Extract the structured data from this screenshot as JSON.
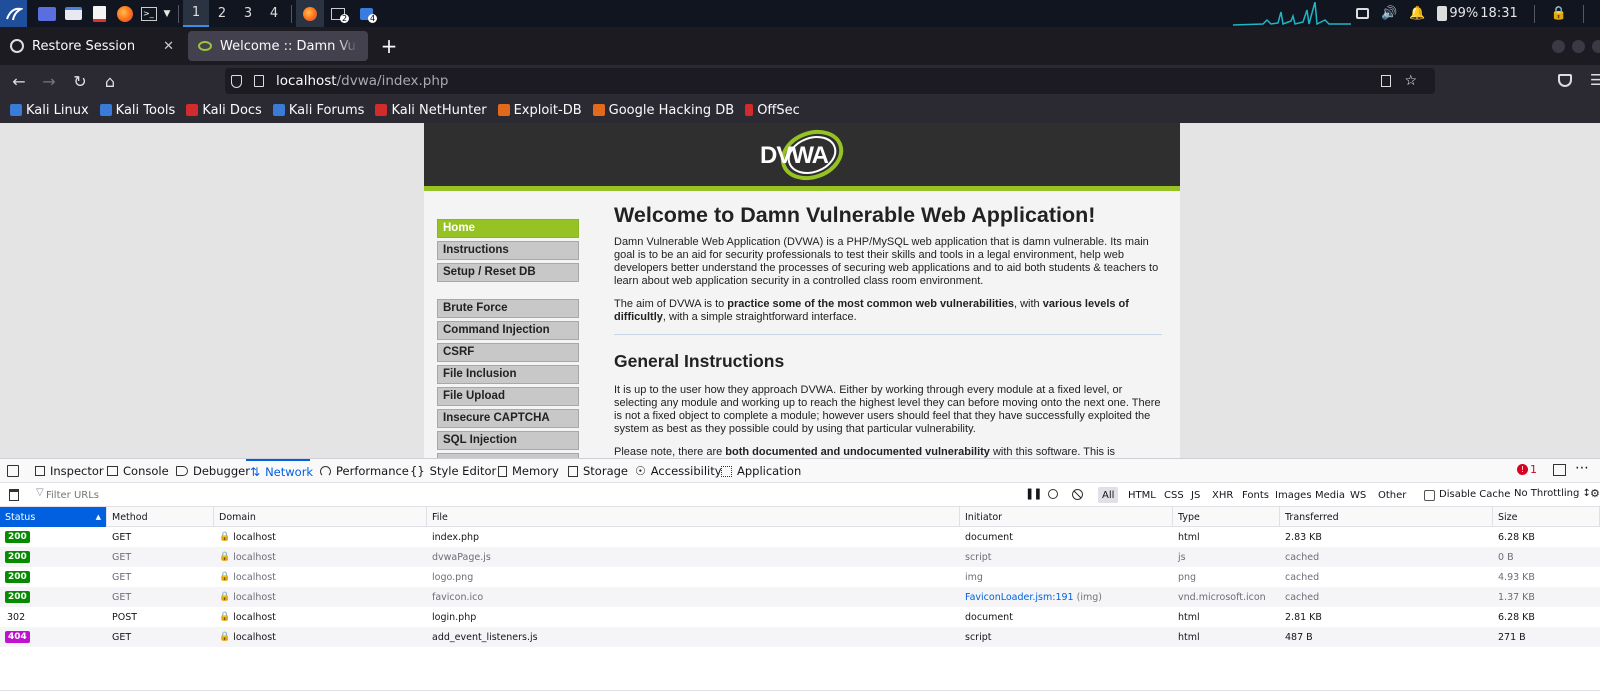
{
  "panel": {
    "workspaces": [
      "1",
      "2",
      "3",
      "4"
    ],
    "active_workspace": "1",
    "tray_badge_2": "2",
    "tray_badge_4": "4",
    "battery": "99%",
    "clock": "18:31"
  },
  "tabs": [
    {
      "title": "Restore Session",
      "active": false
    },
    {
      "title": "Welcome :: Damn Vulnerable",
      "active": true
    }
  ],
  "newtab_label": "+",
  "url": {
    "host": "localhost",
    "path": "/dvwa/index.php"
  },
  "bookmarks": [
    {
      "label": "Kali Linux",
      "color": "#3b7bd8"
    },
    {
      "label": "Kali Tools",
      "color": "#3b7bd8"
    },
    {
      "label": "Kali Docs",
      "color": "#d12b2b"
    },
    {
      "label": "Kali Forums",
      "color": "#3b7bd8"
    },
    {
      "label": "Kali NetHunter",
      "color": "#d12b2b"
    },
    {
      "label": "Exploit-DB",
      "color": "#e36a1c"
    },
    {
      "label": "Google Hacking DB",
      "color": "#e36a1c"
    },
    {
      "label": "OffSec",
      "color": "#d12b2b"
    }
  ],
  "dvwa": {
    "logo_text": "DVWA",
    "menu_group1": [
      "Home",
      "Instructions",
      "Setup / Reset DB"
    ],
    "menu_group2": [
      "Brute Force",
      "Command Injection",
      "CSRF",
      "File Inclusion",
      "File Upload",
      "Insecure CAPTCHA",
      "SQL Injection"
    ],
    "heading": "Welcome to Damn Vulnerable Web Application!",
    "intro": "Damn Vulnerable Web Application (DVWA) is a PHP/MySQL web application that is damn vulnerable. Its main goal is to be an aid for security professionals to test their skills and tools in a legal environment, help web developers better understand the processes of securing web applications and to aid both students & teachers to learn about web application security in a controlled class room environment.",
    "aim_pre": "The aim of DVWA is to ",
    "aim_b1": "practice some of the most common web vulnerabilities",
    "aim_mid": ", with ",
    "aim_b2": "various levels of difficultly",
    "aim_post": ", with a simple straightforward interface.",
    "general_heading": "General Instructions",
    "general_p": "It is up to the user how they approach DVWA. Either by working through every module at a fixed level, or selecting any module and working up to reach the highest level they can before moving onto the next one. There is not a fixed object to complete a module; however users should feel that they have successfully exploited the system as best as they possible could by using that particular vulnerability.",
    "note_pre": "Please note, there are ",
    "note_b": "both documented and undocumented vulnerability",
    "note_post": " with this software. This is"
  },
  "devtools": {
    "tabs": [
      "Inspector",
      "Console",
      "Debugger",
      "Network",
      "Performance",
      "Style Editor",
      "Memory",
      "Storage",
      "Accessibility",
      "Application"
    ],
    "active_tab": "Network",
    "error_count": "1",
    "filter_placeholder": "Filter URLs",
    "type_filters": [
      "All",
      "HTML",
      "CSS",
      "JS",
      "XHR",
      "Fonts",
      "Images",
      "Media",
      "WS",
      "Other"
    ],
    "disable_cache_label": "Disable Cache",
    "throttling_label": "No Throttling ↕",
    "columns": [
      "Status",
      "Method",
      "Domain",
      "File",
      "Initiator",
      "Type",
      "Transferred",
      "Size"
    ],
    "rows": [
      {
        "status": "200",
        "status_color": "#058b00",
        "method": "GET",
        "domain": "localhost",
        "file": "index.php",
        "initiator": "document",
        "initiator_extra": "",
        "type": "html",
        "transferred": "2.83 KB",
        "size": "6.28 KB",
        "dim": false
      },
      {
        "status": "200",
        "status_color": "#058b00",
        "method": "GET",
        "domain": "localhost",
        "file": "dvwaPage.js",
        "initiator": "script",
        "initiator_extra": "",
        "type": "js",
        "transferred": "cached",
        "size": "0 B",
        "dim": true
      },
      {
        "status": "200",
        "status_color": "#058b00",
        "method": "GET",
        "domain": "localhost",
        "file": "logo.png",
        "initiator": "img",
        "initiator_extra": "",
        "type": "png",
        "transferred": "cached",
        "size": "4.93 KB",
        "dim": true
      },
      {
        "status": "200",
        "status_color": "#058b00",
        "method": "GET",
        "domain": "localhost",
        "file": "favicon.ico",
        "initiator": "FaviconLoader.jsm:191",
        "initiator_extra": "(img)",
        "type": "vnd.microsoft.icon",
        "transferred": "cached",
        "size": "1.37 KB",
        "dim": true
      },
      {
        "status": "302",
        "status_color": "",
        "method": "POST",
        "domain": "localhost",
        "file": "login.php",
        "initiator": "document",
        "initiator_extra": "",
        "type": "html",
        "transferred": "2.81 KB",
        "size": "6.28 KB",
        "dim": false
      },
      {
        "status": "404",
        "status_color": "#c010d0",
        "method": "GET",
        "domain": "localhost",
        "file": "add_event_listeners.js",
        "initiator": "script",
        "initiator_extra": "",
        "type": "html",
        "transferred": "487 B",
        "size": "271 B",
        "dim": false
      }
    ]
  }
}
